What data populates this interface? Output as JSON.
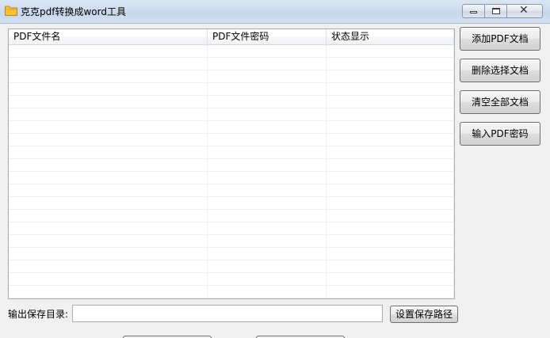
{
  "window": {
    "title": "克克pdf转换成word工具",
    "icon": "folder-icon"
  },
  "caption": {
    "minimize_icon": "minimize-icon",
    "maximize_icon": "maximize-icon",
    "close_glyph": "✕"
  },
  "file_list": {
    "columns": [
      "PDF文件名",
      "PDF文件密码",
      "状态显示"
    ],
    "rows": []
  },
  "actions": {
    "add": "添加PDF文档",
    "delete": "删除选择文档",
    "clear": "清空全部文档",
    "password": "输入PDF密码"
  },
  "output": {
    "label": "输出保存目录:",
    "value": "",
    "set_path": "设置保存路径"
  },
  "colors": {
    "folder": "#f3c13a",
    "titlebar": "#cfdcee"
  }
}
